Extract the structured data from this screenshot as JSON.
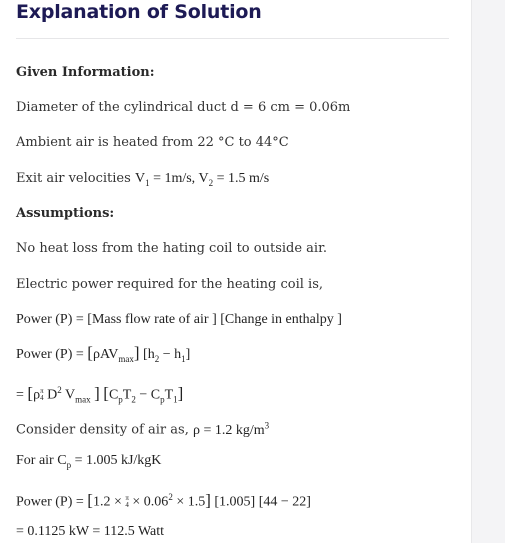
{
  "header": {
    "title": "Explanation of Solution"
  },
  "given": {
    "heading": "Given Information:",
    "diameter": "Diameter of the cylindrical duct d = 6 cm = 0.06m",
    "temperature": "Ambient air is heated from 22 °C to 44°C",
    "velocities_prefix": "Exit air velocities ",
    "v1_label": "V",
    "v1_sub": "1",
    "v1_value": " = 1m/s, ",
    "v2_label": "V",
    "v2_sub": "2",
    "v2_value": " = 1.5 m/s"
  },
  "assumptions": {
    "heading": "Assumptions:",
    "no_heat_loss": "No heat loss from the hating coil to outside air.",
    "power_intro": "Electric power required for the heating coil is,"
  },
  "equations": {
    "eq1": "Power (P) = [Mass flow rate of air ] [Change in enthalpy ]",
    "eq2_prefix": "Power  (P) = ",
    "eq2_body": "ρAV",
    "eq2_sub": "max",
    "eq2_rest": " [h",
    "eq2_h2": "2",
    "eq2_minus": " − h",
    "eq2_h1": "1",
    "eq2_end": "]",
    "eq3_prefix": "= ",
    "eq3_rho": "ρ",
    "eq3_frac_num": "π",
    "eq3_frac_den": "4",
    "eq3_d": " D",
    "eq3_d_sup": "2",
    "eq3_v": " V",
    "eq3_v_sub": "max",
    "eq3_c1": "C",
    "eq3_c1_sub": "p",
    "eq3_t2": "T",
    "eq3_t2_sub": "2",
    "eq3_minus": " − C",
    "eq3_c2_sub": "p",
    "eq3_t1": "T",
    "eq3_t1_sub": "1",
    "density_text": "Consider density of air as, ",
    "density_math": "ρ = 1.2 kg/m",
    "density_sup": "3",
    "cp_text": "For air ",
    "cp_math": "C",
    "cp_sub": "p",
    "cp_value": " = 1.005 kJ/kgK",
    "eq4_prefix": "Power  (P) = ",
    "eq4_a": "1.2 × ",
    "eq4_frac_num": "π",
    "eq4_frac_den": "4",
    "eq4_b": " × 0.06",
    "eq4_sup": "2",
    "eq4_c": " × 1.5",
    "eq4_rest": " [1.005] [44 − 22]",
    "result": "= 0.1125 kW = 112.5 Watt"
  }
}
